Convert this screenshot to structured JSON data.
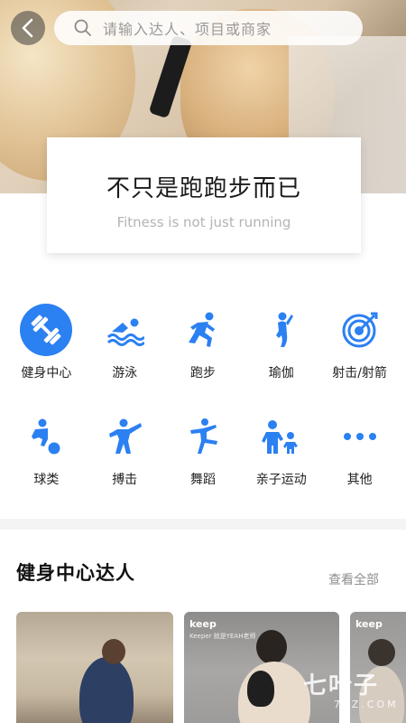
{
  "header": {
    "search_placeholder": "请输入达人、项目或商家"
  },
  "banner": {
    "title": "不只是跑跑步而已",
    "subtitle": "Fitness is not just running"
  },
  "categories": [
    {
      "label": "健身中心",
      "icon": "dumbbell-icon",
      "active": true
    },
    {
      "label": "游泳",
      "icon": "swimming-icon"
    },
    {
      "label": "跑步",
      "icon": "running-icon"
    },
    {
      "label": "瑜伽",
      "icon": "yoga-icon"
    },
    {
      "label": "射击/射箭",
      "icon": "target-icon"
    },
    {
      "label": "球类",
      "icon": "ball-sports-icon"
    },
    {
      "label": "搏击",
      "icon": "combat-icon"
    },
    {
      "label": "舞蹈",
      "icon": "dance-icon"
    },
    {
      "label": "亲子运动",
      "icon": "family-icon"
    },
    {
      "label": "其他",
      "icon": "more-dots-icon"
    }
  ],
  "section": {
    "title": "健身中心达人",
    "see_all": "查看全部"
  },
  "cards": [
    {
      "brand": ""
    },
    {
      "brand": "keep",
      "sub": "Keeper 就是YEAH老师"
    },
    {
      "brand": "keep"
    }
  ],
  "watermark": {
    "line1": "七叶子",
    "line2": "7YZ.COM"
  },
  "colors": {
    "accent": "#2b80f2",
    "text": "#222222",
    "muted": "#8e8e8e"
  }
}
